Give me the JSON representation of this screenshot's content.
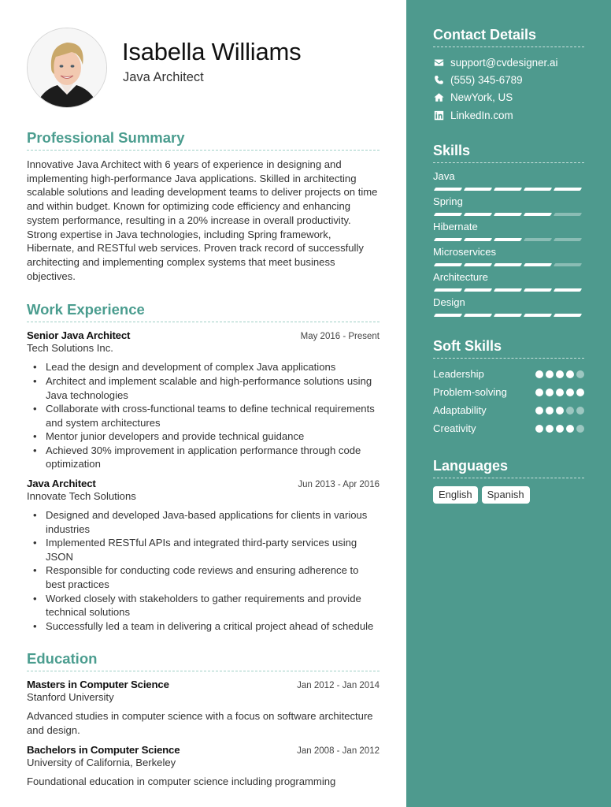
{
  "profile": {
    "name": "Isabella Williams",
    "title": "Java Architect",
    "photo_icon": "profile-photo"
  },
  "colors": {
    "accent": "#4b9d8f",
    "sidebar_bg": "#4e9a8e",
    "text": "#333333"
  },
  "summary": {
    "heading": "Professional Summary",
    "text": "Innovative Java Architect with 6 years of experience in designing and implementing high-performance Java applications. Skilled in architecting scalable solutions and leading development teams to deliver projects on time and within budget. Known for optimizing code efficiency and enhancing system performance, resulting in a 20% increase in overall productivity. Strong expertise in Java technologies, including Spring framework, Hibernate, and RESTful web services. Proven track record of successfully architecting and implementing complex systems that meet business objectives."
  },
  "experience": {
    "heading": "Work Experience",
    "jobs": [
      {
        "role": "Senior Java Architect",
        "dates": "May 2016 - Present",
        "company": "Tech Solutions Inc.",
        "bullets": [
          "Lead the design and development of complex Java applications",
          "Architect and implement scalable and high-performance solutions using Java technologies",
          "Collaborate with cross-functional teams to define technical requirements and system architectures",
          "Mentor junior developers and provide technical guidance",
          "Achieved 30% improvement in application performance through code optimization"
        ]
      },
      {
        "role": "Java Architect",
        "dates": "Jun 2013 - Apr 2016",
        "company": "Innovate Tech Solutions",
        "bullets": [
          "Designed and developed Java-based applications for clients in various industries",
          "Implemented RESTful APIs and integrated third-party services using JSON",
          "Responsible for conducting code reviews and ensuring adherence to best practices",
          "Worked closely with stakeholders to gather requirements and provide technical solutions",
          "Successfully led a team in delivering a critical project ahead of schedule"
        ]
      }
    ]
  },
  "education": {
    "heading": "Education",
    "items": [
      {
        "degree": "Masters in Computer Science",
        "dates": "Jan 2012 - Jan 2014",
        "school": "Stanford University",
        "description": "Advanced studies in computer science with a focus on software architecture and design."
      },
      {
        "degree": "Bachelors in Computer Science",
        "dates": "Jan 2008 - Jan 2012",
        "school": "University of California, Berkeley",
        "description": "Foundational education in computer science including programming"
      }
    ]
  },
  "contact": {
    "heading": "Contact Details",
    "items": [
      {
        "icon": "envelope-icon",
        "text": "support@cvdesigner.ai"
      },
      {
        "icon": "phone-icon",
        "text": "(555) 345-6789"
      },
      {
        "icon": "home-icon",
        "text": "NewYork, US"
      },
      {
        "icon": "linkedin-icon",
        "text": "LinkedIn.com"
      }
    ]
  },
  "skills": {
    "heading": "Skills",
    "max": 5,
    "items": [
      {
        "name": "Java",
        "level": 5
      },
      {
        "name": "Spring",
        "level": 4
      },
      {
        "name": "Hibernate",
        "level": 3
      },
      {
        "name": "Microservices",
        "level": 4
      },
      {
        "name": "Architecture",
        "level": 5
      },
      {
        "name": "Design",
        "level": 5
      }
    ]
  },
  "soft_skills": {
    "heading": "Soft Skills",
    "max": 5,
    "items": [
      {
        "name": "Leadership",
        "level": 4
      },
      {
        "name": "Problem-solving",
        "level": 5
      },
      {
        "name": "Adaptability",
        "level": 3
      },
      {
        "name": "Creativity",
        "level": 4
      }
    ]
  },
  "languages": {
    "heading": "Languages",
    "items": [
      "English",
      "Spanish"
    ]
  }
}
